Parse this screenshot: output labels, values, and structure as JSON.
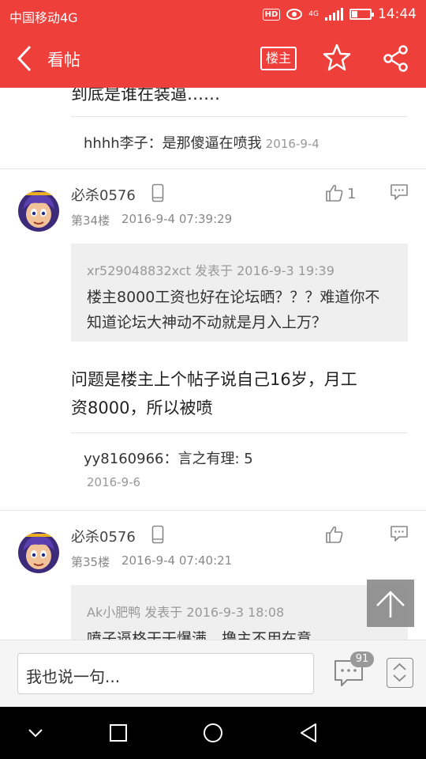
{
  "status_bar": {
    "carrier": "中国移动4G",
    "hd": "HD",
    "net": "4G",
    "time": "14:44"
  },
  "header": {
    "title": "看帖",
    "owner_label": "楼主",
    "back_icon": "back-arrow-icon",
    "star_icon": "star-icon",
    "share_icon": "share-icon",
    "bg_color": "#ee3f3a"
  },
  "top_fragment": {
    "text": "到底是谁在装逼……",
    "reply": {
      "user": "hhhh李子：",
      "text": "是那傻逼在喷我",
      "date": "2016-9-4"
    }
  },
  "posts": [
    {
      "name": "必杀0576",
      "device_icon": "phone-icon",
      "floor": "第34楼",
      "datetime": "2016-9-4 07:39:29",
      "likes": "1",
      "quote": {
        "header": "xr529048832xct 发表于 2016-9-3 19:39",
        "body": "楼主8000工资也好在论坛晒？？？难道你不知道论坛大神动不动就是月入上万？"
      },
      "body_line1": "问题是楼主上个帖子说自己16岁，月工",
      "body_line2": "资8000，所以被喷",
      "reply": {
        "user": "yy8160966：",
        "text": "言之有理: 5",
        "date": "2016-9-6"
      }
    },
    {
      "name": "必杀0576",
      "device_icon": "phone-icon",
      "floor": "第35楼",
      "datetime": "2016-9-4 07:40:21",
      "likes": "",
      "quote": {
        "header": "Ak小肥鸭 发表于 2016-9-3 18:08",
        "body": "喷子逼格干干爆满，撸主不用在意"
      }
    }
  ],
  "bottom_bar": {
    "placeholder": "我也说一句...",
    "comment_count": "91"
  },
  "nav_bar": {
    "back": "nav-back-icon",
    "home": "nav-home-icon",
    "recents": "nav-recents-icon",
    "down": "nav-down-icon"
  }
}
